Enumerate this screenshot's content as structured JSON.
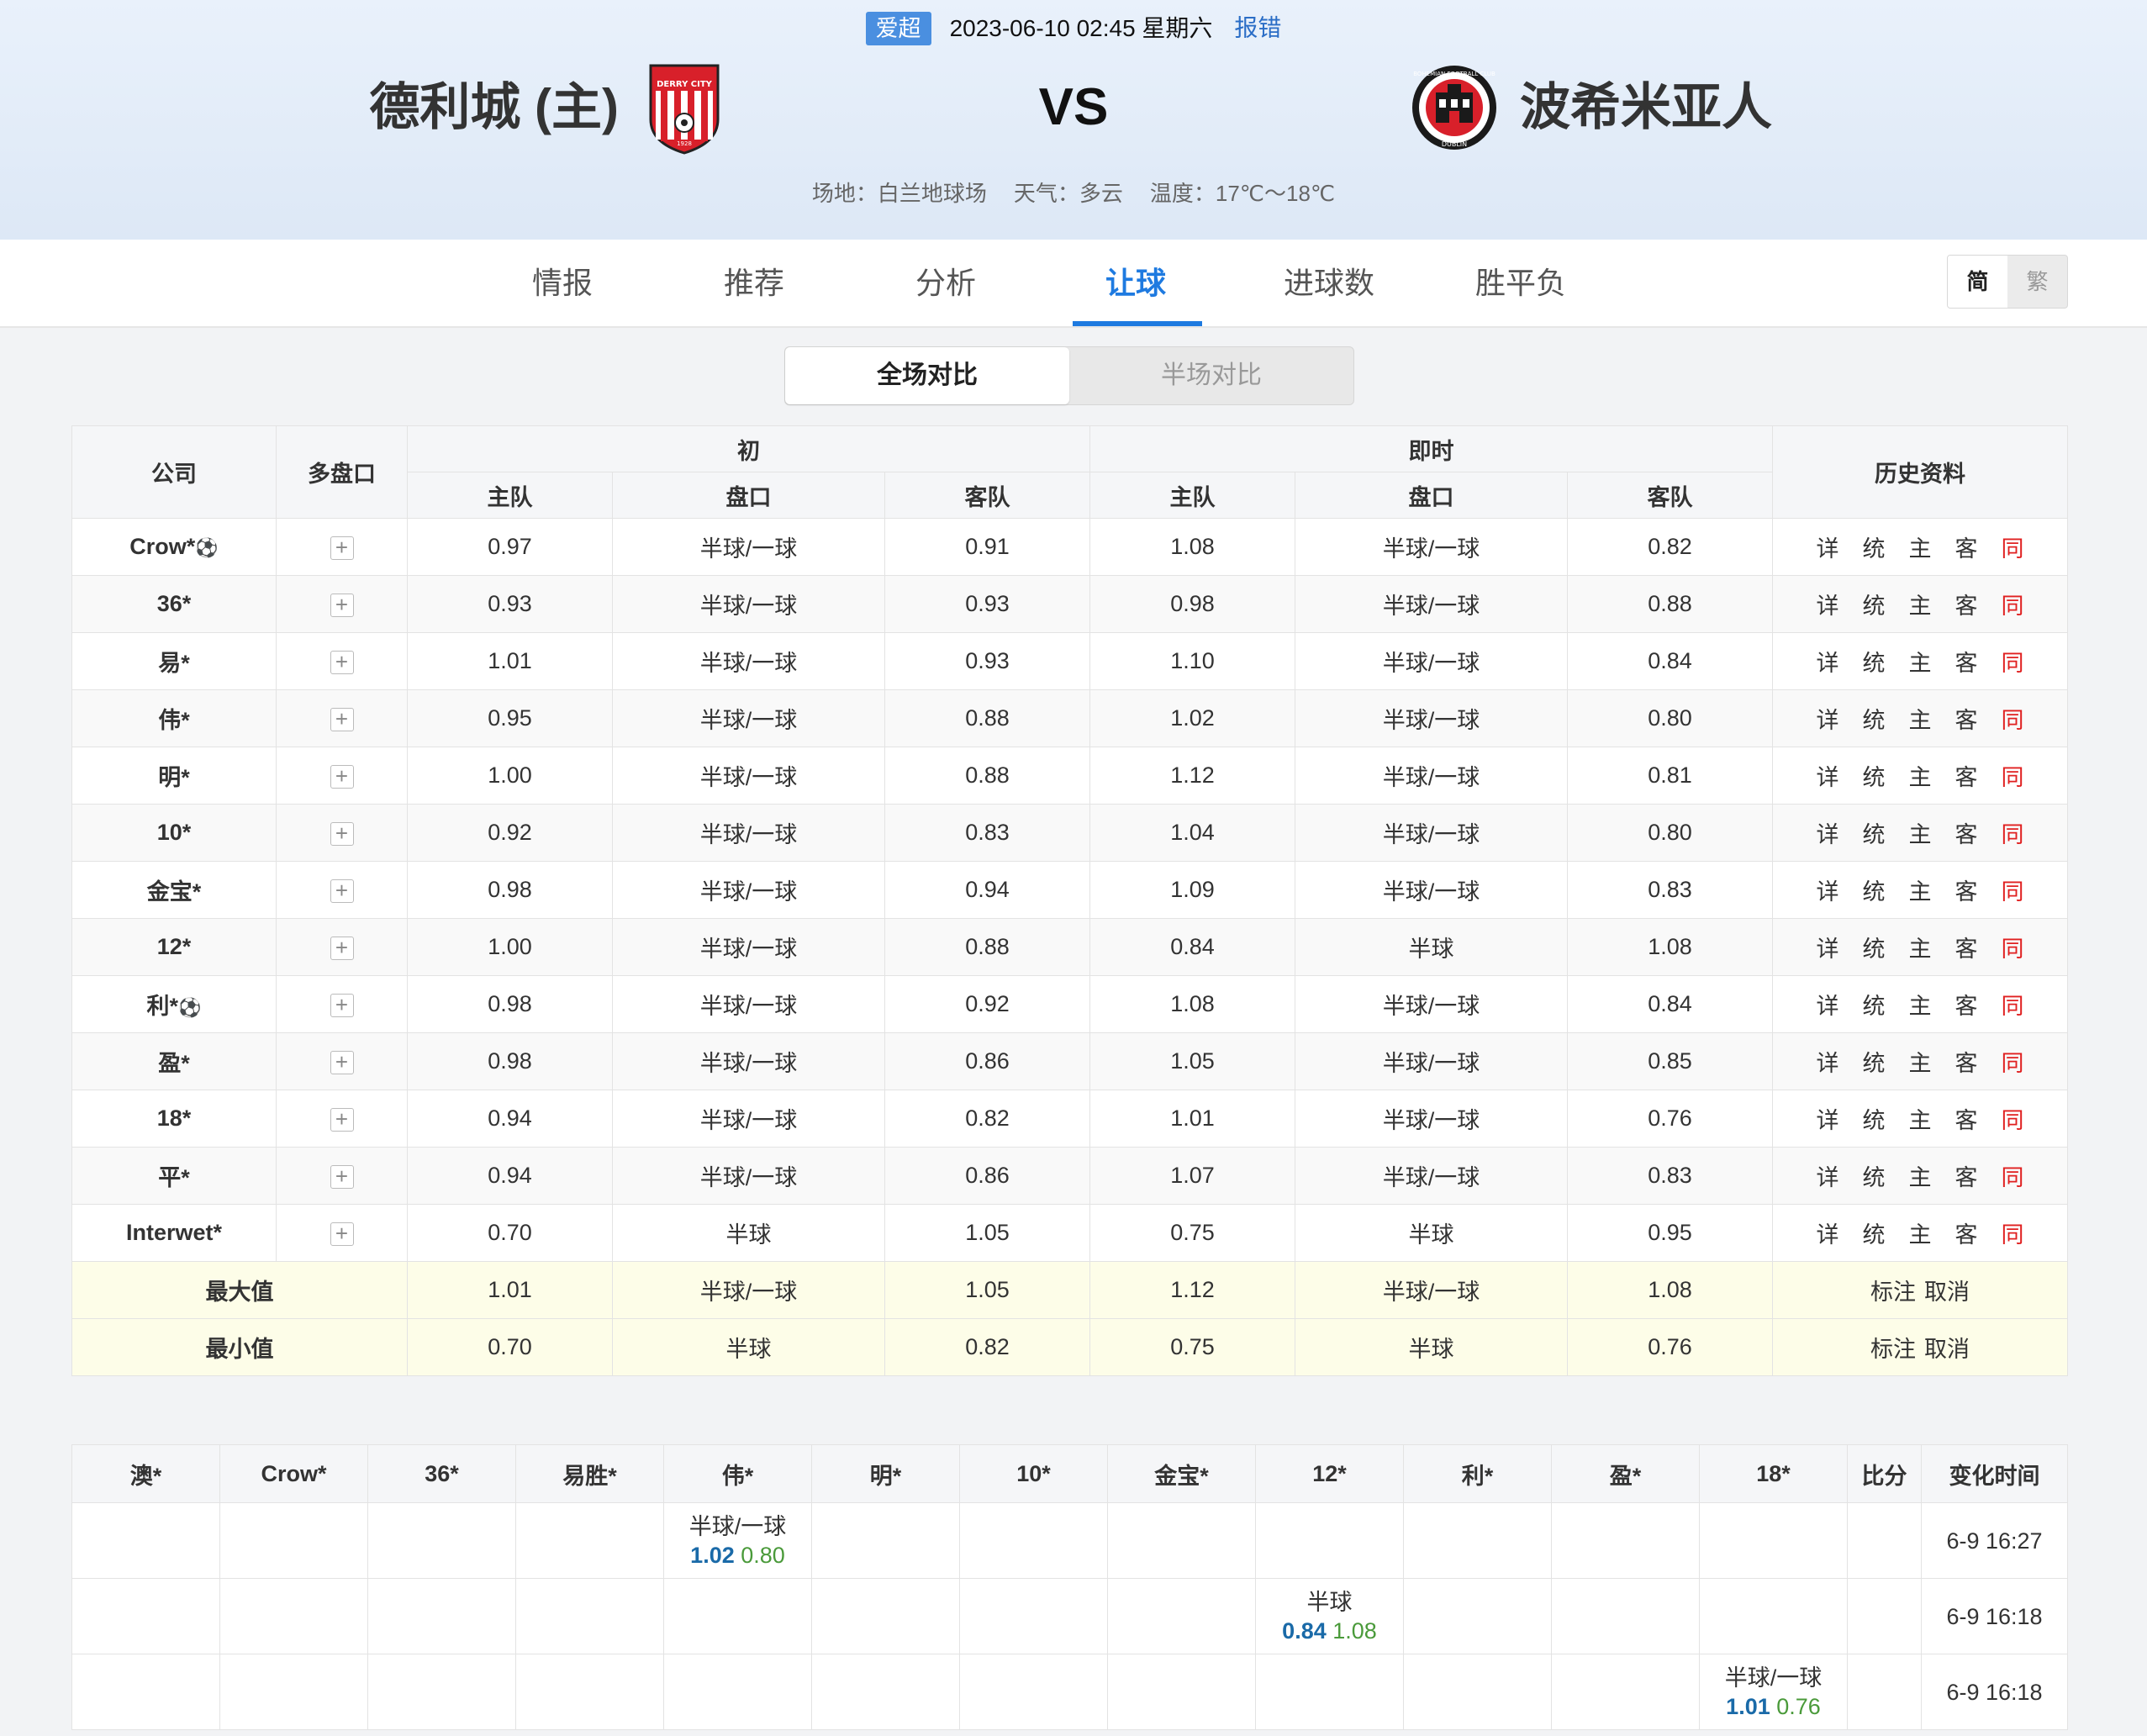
{
  "header": {
    "league": "爱超",
    "datetime": "2023-06-10 02:45 星期六",
    "report": "报错",
    "home_team": "德利城 (主)",
    "away_team": "波希米亚人",
    "vs": "VS",
    "venue": "场地：白兰地球场",
    "weather": "天气：多云",
    "temperature": "温度：17℃～18℃",
    "home_logo_text": "DERRY CITY",
    "home_logo_year": "1928",
    "away_logo_text": "BOHEMIAN FOOTBALL CLUB",
    "away_logo_city": "DUBLIN"
  },
  "tabs": [
    "情报",
    "推荐",
    "分析",
    "让球",
    "进球数",
    "胜平负"
  ],
  "active_tab": "让球",
  "lang": {
    "simplified": "简",
    "traditional": "繁"
  },
  "segment": {
    "full": "全场对比",
    "half": "半场对比"
  },
  "colors": {
    "accent": "#1e7ae0",
    "same": "#e02020",
    "summary_bg": "#fdfde8"
  },
  "odds_table": {
    "headers": {
      "company": "公司",
      "multi": "多盘口",
      "initial": "初",
      "live": "即时",
      "history": "历史资料",
      "home": "主队",
      "line": "盘口",
      "away": "客队"
    },
    "rows": [
      {
        "company": "Crow*",
        "ball": true,
        "i_home": "0.97",
        "i_line": "半球/一球",
        "i_away": "0.91",
        "l_home": "1.08",
        "l_line": "半球/一球",
        "l_away": "0.82"
      },
      {
        "company": "36*",
        "ball": false,
        "i_home": "0.93",
        "i_line": "半球/一球",
        "i_away": "0.93",
        "l_home": "0.98",
        "l_line": "半球/一球",
        "l_away": "0.88"
      },
      {
        "company": "易*",
        "ball": false,
        "i_home": "1.01",
        "i_line": "半球/一球",
        "i_away": "0.93",
        "l_home": "1.10",
        "l_line": "半球/一球",
        "l_away": "0.84"
      },
      {
        "company": "伟*",
        "ball": false,
        "i_home": "0.95",
        "i_line": "半球/一球",
        "i_away": "0.88",
        "l_home": "1.02",
        "l_line": "半球/一球",
        "l_away": "0.80"
      },
      {
        "company": "明*",
        "ball": false,
        "i_home": "1.00",
        "i_line": "半球/一球",
        "i_away": "0.88",
        "l_home": "1.12",
        "l_line": "半球/一球",
        "l_away": "0.81"
      },
      {
        "company": "10*",
        "ball": false,
        "i_home": "0.92",
        "i_line": "半球/一球",
        "i_away": "0.83",
        "l_home": "1.04",
        "l_line": "半球/一球",
        "l_away": "0.80"
      },
      {
        "company": "金宝*",
        "ball": false,
        "i_home": "0.98",
        "i_line": "半球/一球",
        "i_away": "0.94",
        "l_home": "1.09",
        "l_line": "半球/一球",
        "l_away": "0.83"
      },
      {
        "company": "12*",
        "ball": false,
        "i_home": "1.00",
        "i_line": "半球/一球",
        "i_away": "0.88",
        "l_home": "0.84",
        "l_line": "半球",
        "l_away": "1.08"
      },
      {
        "company": "利*",
        "ball": true,
        "i_home": "0.98",
        "i_line": "半球/一球",
        "i_away": "0.92",
        "l_home": "1.08",
        "l_line": "半球/一球",
        "l_away": "0.84"
      },
      {
        "company": "盈*",
        "ball": false,
        "i_home": "0.98",
        "i_line": "半球/一球",
        "i_away": "0.86",
        "l_home": "1.05",
        "l_line": "半球/一球",
        "l_away": "0.85"
      },
      {
        "company": "18*",
        "ball": false,
        "i_home": "0.94",
        "i_line": "半球/一球",
        "i_away": "0.82",
        "l_home": "1.01",
        "l_line": "半球/一球",
        "l_away": "0.76"
      },
      {
        "company": "平*",
        "ball": false,
        "i_home": "0.94",
        "i_line": "半球/一球",
        "i_away": "0.86",
        "l_home": "1.07",
        "l_line": "半球/一球",
        "l_away": "0.83"
      },
      {
        "company": "Interwet*",
        "ball": false,
        "i_home": "0.70",
        "i_line": "半球",
        "i_away": "1.05",
        "l_home": "0.75",
        "l_line": "半球",
        "l_away": "0.95"
      }
    ],
    "history_links": {
      "detail": "详",
      "stats": "统",
      "home": "主",
      "away": "客",
      "same": "同"
    },
    "ball_icon": "⚽",
    "plus": "+",
    "summary": [
      {
        "label": "最大值",
        "i_home": "1.01",
        "i_line": "半球/一球",
        "i_away": "1.05",
        "l_home": "1.12",
        "l_line": "半球/一球",
        "l_away": "1.08",
        "mark": "标注",
        "cancel": "取消"
      },
      {
        "label": "最小值",
        "i_home": "0.70",
        "i_line": "半球",
        "i_away": "0.82",
        "l_home": "0.75",
        "l_line": "半球",
        "l_away": "0.76",
        "mark": "标注",
        "cancel": "取消"
      }
    ]
  },
  "change_table": {
    "headers": [
      "澳*",
      "Crow*",
      "36*",
      "易胜*",
      "伟*",
      "明*",
      "10*",
      "金宝*",
      "12*",
      "利*",
      "盈*",
      "18*",
      "比分",
      "变化时间"
    ],
    "rows": [
      {
        "col": 4,
        "line": "半球/一球",
        "home": "1.02",
        "away": "0.80",
        "time": "6-9 16:27"
      },
      {
        "col": 8,
        "line": "半球",
        "home": "0.84",
        "away": "1.08",
        "time": "6-9 16:18"
      },
      {
        "col": 11,
        "line": "半球/一球",
        "home": "1.01",
        "away": "0.76",
        "time": "6-9 16:18"
      }
    ]
  }
}
